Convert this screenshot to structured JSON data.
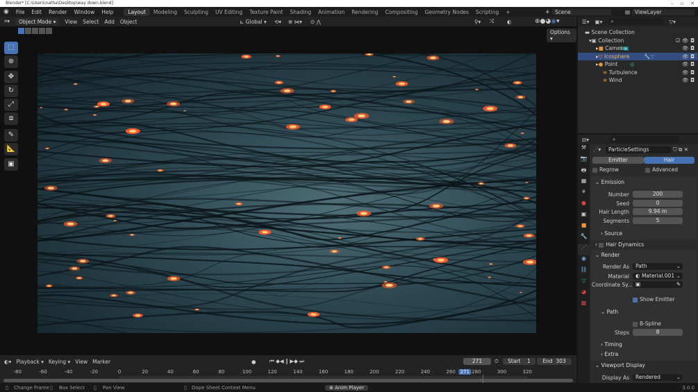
{
  "title": "Blender* [C:\\Users\\natha\\Desktop\\way down.blend]",
  "menu": [
    "File",
    "Edit",
    "Render",
    "Window",
    "Help"
  ],
  "workspaces": [
    "Layout",
    "Modeling",
    "Sculpting",
    "UV Editing",
    "Texture Paint",
    "Shading",
    "Animation",
    "Rendering",
    "Compositing",
    "Geometry Nodes",
    "Scripting",
    "+"
  ],
  "scene": "Scene",
  "view_layer": "ViewLayer",
  "header": {
    "mode": "Object Mode",
    "menus": [
      "View",
      "Select",
      "Add",
      "Object"
    ],
    "orientation": "Global",
    "options": "Options"
  },
  "outliner": {
    "root": "Scene Collection",
    "items": [
      {
        "name": "Collection",
        "icon": "collection-icon"
      },
      {
        "name": "Camera",
        "icon": "camera-icon"
      },
      {
        "name": "Icosphere",
        "icon": "mesh-icon",
        "selected": true
      },
      {
        "name": "Point",
        "icon": "light-icon"
      },
      {
        "name": "Turbulence",
        "icon": "force-field-icon"
      },
      {
        "name": "Wind",
        "icon": "force-field-icon"
      }
    ]
  },
  "properties": {
    "datablock": "ParticleSettings",
    "type_tabs": [
      "Emitter",
      "Hair"
    ],
    "type_active": "Hair",
    "regrow": "Regrow",
    "advanced": "Advanced",
    "emission": {
      "title": "Emission",
      "number_label": "Number",
      "number": "200",
      "seed_label": "Seed",
      "seed": "0",
      "hair_length_label": "Hair Length",
      "hair_length": "9.94 m",
      "segments_label": "Segments",
      "segments": "5",
      "source": "Source"
    },
    "hair_dynamics": "Hair Dynamics",
    "render": {
      "title": "Render",
      "render_as_label": "Render As",
      "render_as": "Path",
      "material_label": "Material",
      "material": "Material.001",
      "coord_label": "Coordinate Sy...",
      "show_emitter": "Show Emitter",
      "path": "Path",
      "bspline": "B-Spline",
      "steps_label": "Steps",
      "steps": "8",
      "timing": "Timing",
      "extra": "Extra"
    },
    "viewport_display": {
      "title": "Viewport Display",
      "display_as_label": "Display As",
      "display_as": "Rendered"
    }
  },
  "timeline": {
    "menus": [
      "Playback",
      "Keying",
      "View",
      "Marker"
    ],
    "current_frame": "271",
    "start_label": "Start",
    "start": "1",
    "end_label": "End",
    "end": "303",
    "ticks": [
      "-80",
      "-60",
      "-40",
      "-20",
      "0",
      "20",
      "40",
      "60",
      "80",
      "100",
      "120",
      "140",
      "160",
      "180",
      "200",
      "220",
      "240",
      "260",
      "271",
      "280",
      "300",
      "320"
    ]
  },
  "status": {
    "items": [
      "Change Frame",
      "Box Select",
      "Pan View",
      "Dope Sheet Context Menu"
    ],
    "anim_player": "Anim Player",
    "version": "3.0.0"
  },
  "colors": {
    "accent": "#4772b3",
    "selected_row": "#334d80"
  }
}
